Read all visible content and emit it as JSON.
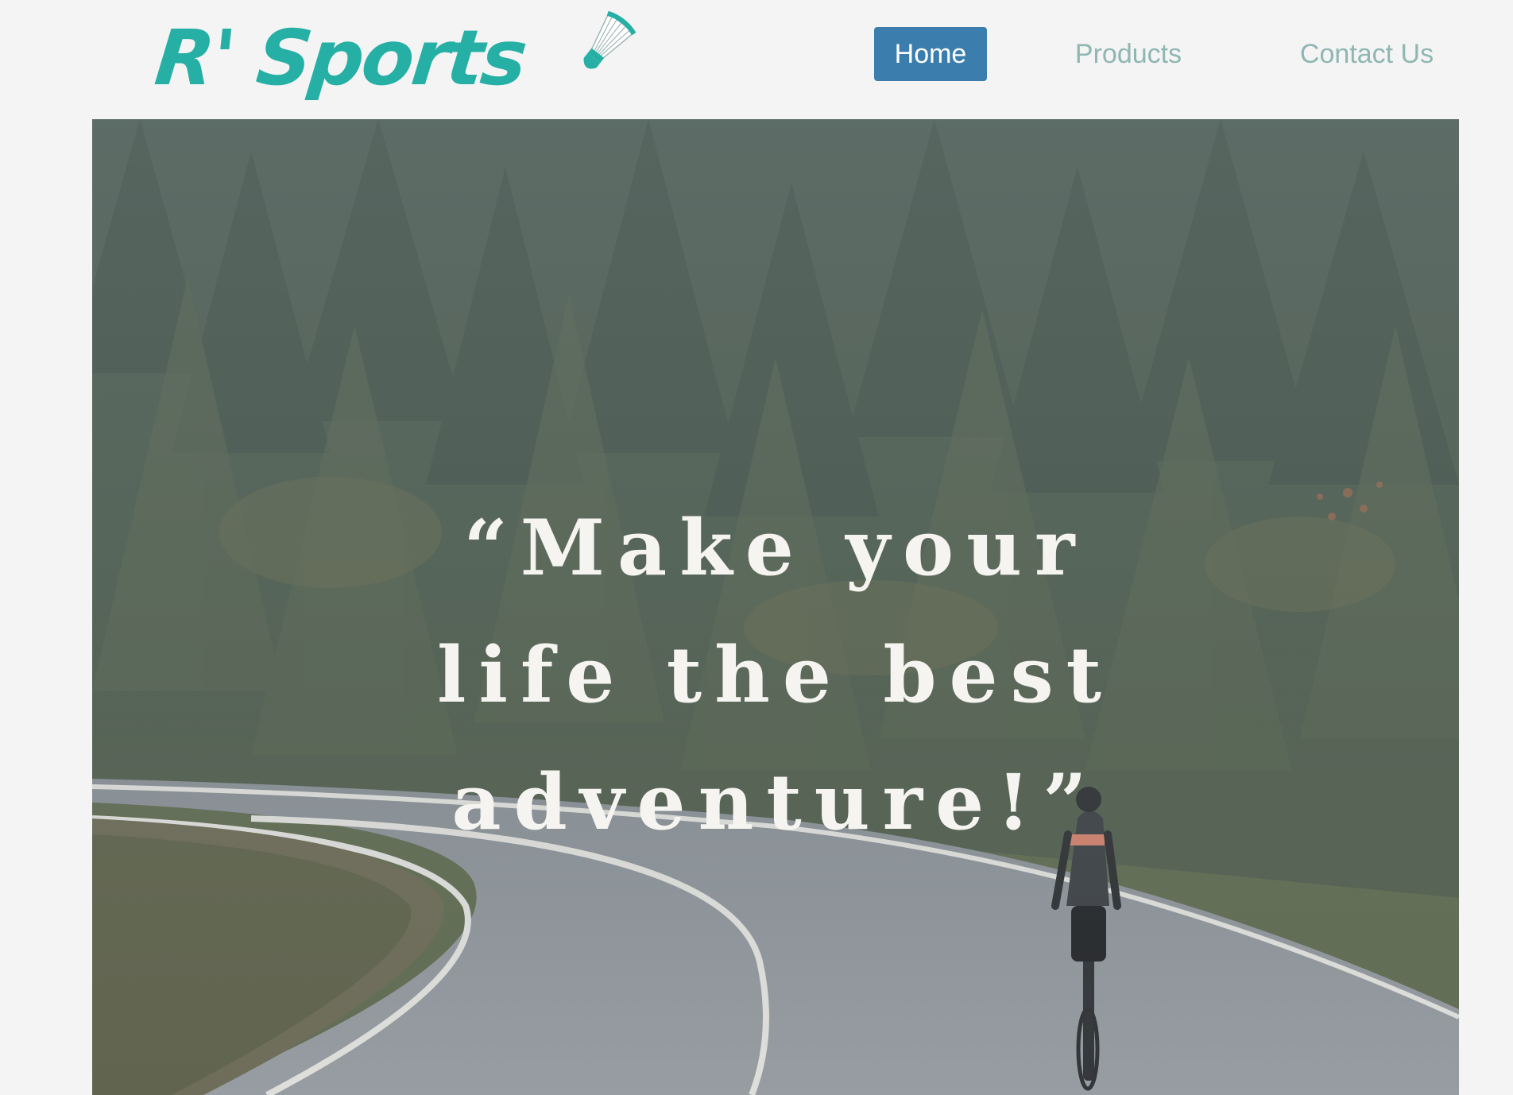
{
  "brand": {
    "name": "R' Sports",
    "logo_icon": "shuttlecock-icon",
    "accent_color": "#26b0a5"
  },
  "nav": {
    "items": [
      {
        "label": "Home",
        "active": true
      },
      {
        "label": "Products",
        "active": false
      },
      {
        "label": "Contact Us",
        "active": false
      }
    ],
    "active_color": "#3b7eae",
    "inactive_text_color": "#8fb7b2"
  },
  "hero": {
    "quote_line1": "“Make your",
    "quote_line2": "life the best",
    "quote_line3": "adventure!”",
    "image": "forest-road-cyclist-photo"
  }
}
